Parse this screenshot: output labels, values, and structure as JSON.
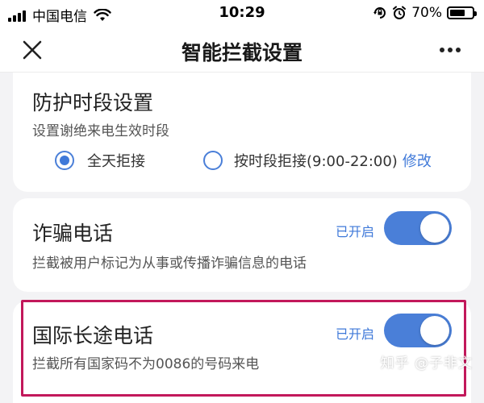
{
  "status_bar": {
    "carrier": "中国电信",
    "time": "10:29",
    "battery_percent": "70%",
    "battery_level": 0.7,
    "icons": [
      "signal-icon",
      "wifi-icon",
      "orientation-lock-icon",
      "alarm-icon",
      "battery-icon"
    ]
  },
  "nav": {
    "title": "智能拦截设置",
    "close_icon": "close-icon",
    "more_icon": "more-icon"
  },
  "protection_period": {
    "title": "防护时段设置",
    "description": "设置谢绝来电生效时段",
    "options": [
      {
        "label": "全天拒接",
        "checked": true
      },
      {
        "label": "按时段拒接(9:00-22:00)",
        "checked": false
      }
    ],
    "edit_label": "修改"
  },
  "fraud_calls": {
    "title": "诈骗电话",
    "description": "拦截被用户标记为从事或传播诈骗信息的电话",
    "state_label": "已开启",
    "enabled": true
  },
  "international_calls": {
    "title": "国际长途电话",
    "description": "拦截所有国家码不为0086的号码来电",
    "state_label": "已开启",
    "enabled": true
  },
  "watermark": "知乎 @子非文",
  "colors": {
    "accent": "#3f79d9",
    "highlight": "#c2185b",
    "background": "#f3f3f5"
  }
}
